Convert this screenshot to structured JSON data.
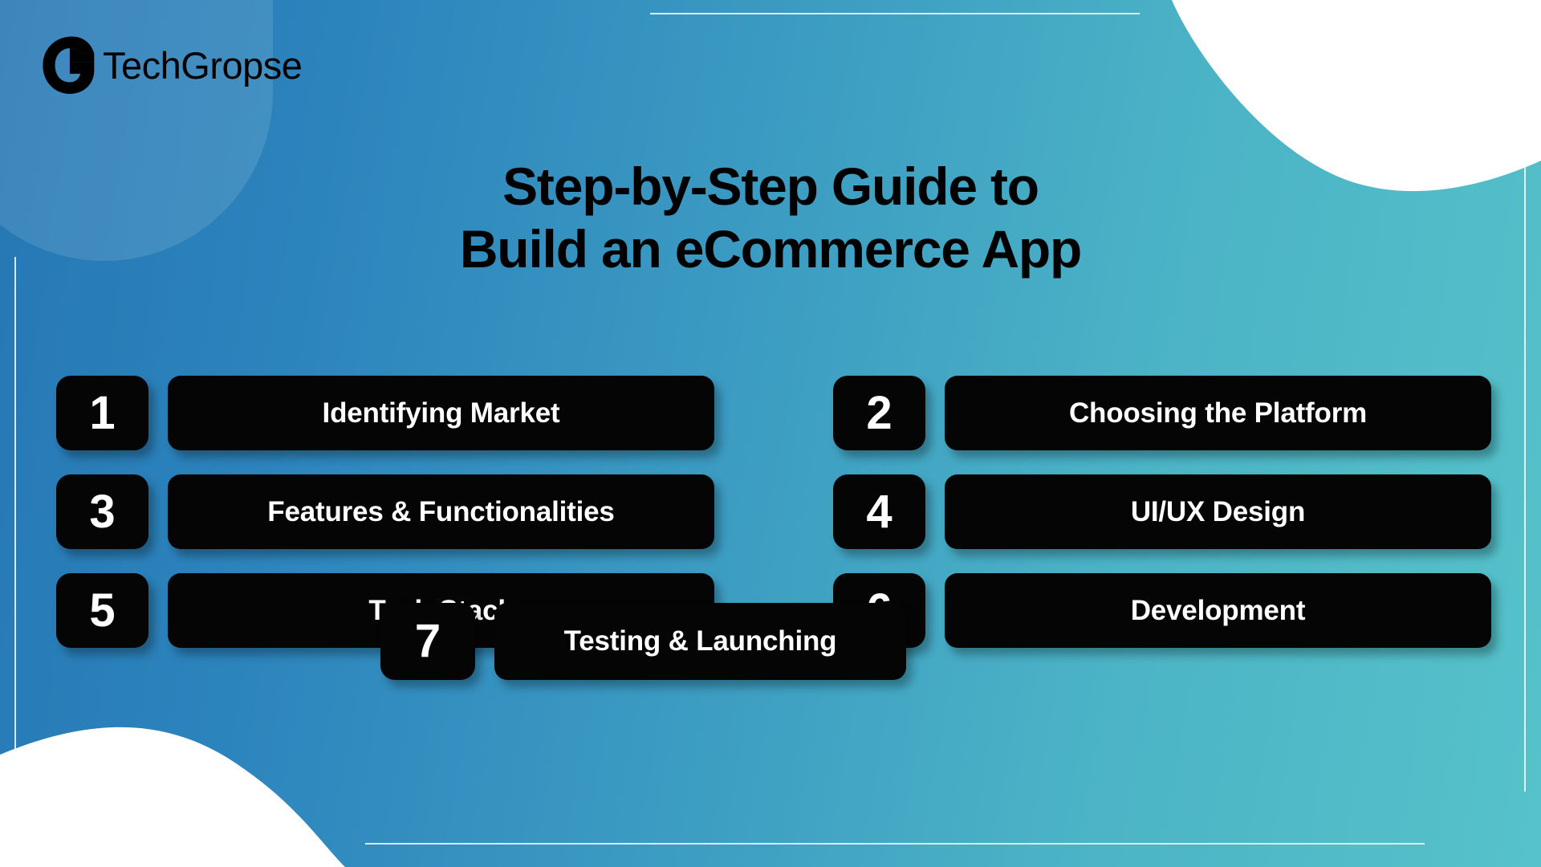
{
  "brand": {
    "logo_icon": "techgropse-g-logo",
    "name": "TechGropse"
  },
  "title": {
    "line1": "Step-by-Step Guide to",
    "line2": "Build an eCommerce App"
  },
  "steps": [
    {
      "number": "1",
      "label": "Identifying Market"
    },
    {
      "number": "2",
      "label": "Choosing the Platform"
    },
    {
      "number": "3",
      "label": "Features & Functionalities"
    },
    {
      "number": "4",
      "label": "UI/UX Design"
    },
    {
      "number": "5",
      "label": "Tech Stack"
    },
    {
      "number": "6",
      "label": "Development"
    },
    {
      "number": "7",
      "label": "Testing & Launching"
    }
  ],
  "colors": {
    "background_left": "#2577b4",
    "background_right": "#56c2c9",
    "card": "#050505",
    "card_text": "#ffffff",
    "title_text": "#000000",
    "decoration": "#ffffff"
  }
}
